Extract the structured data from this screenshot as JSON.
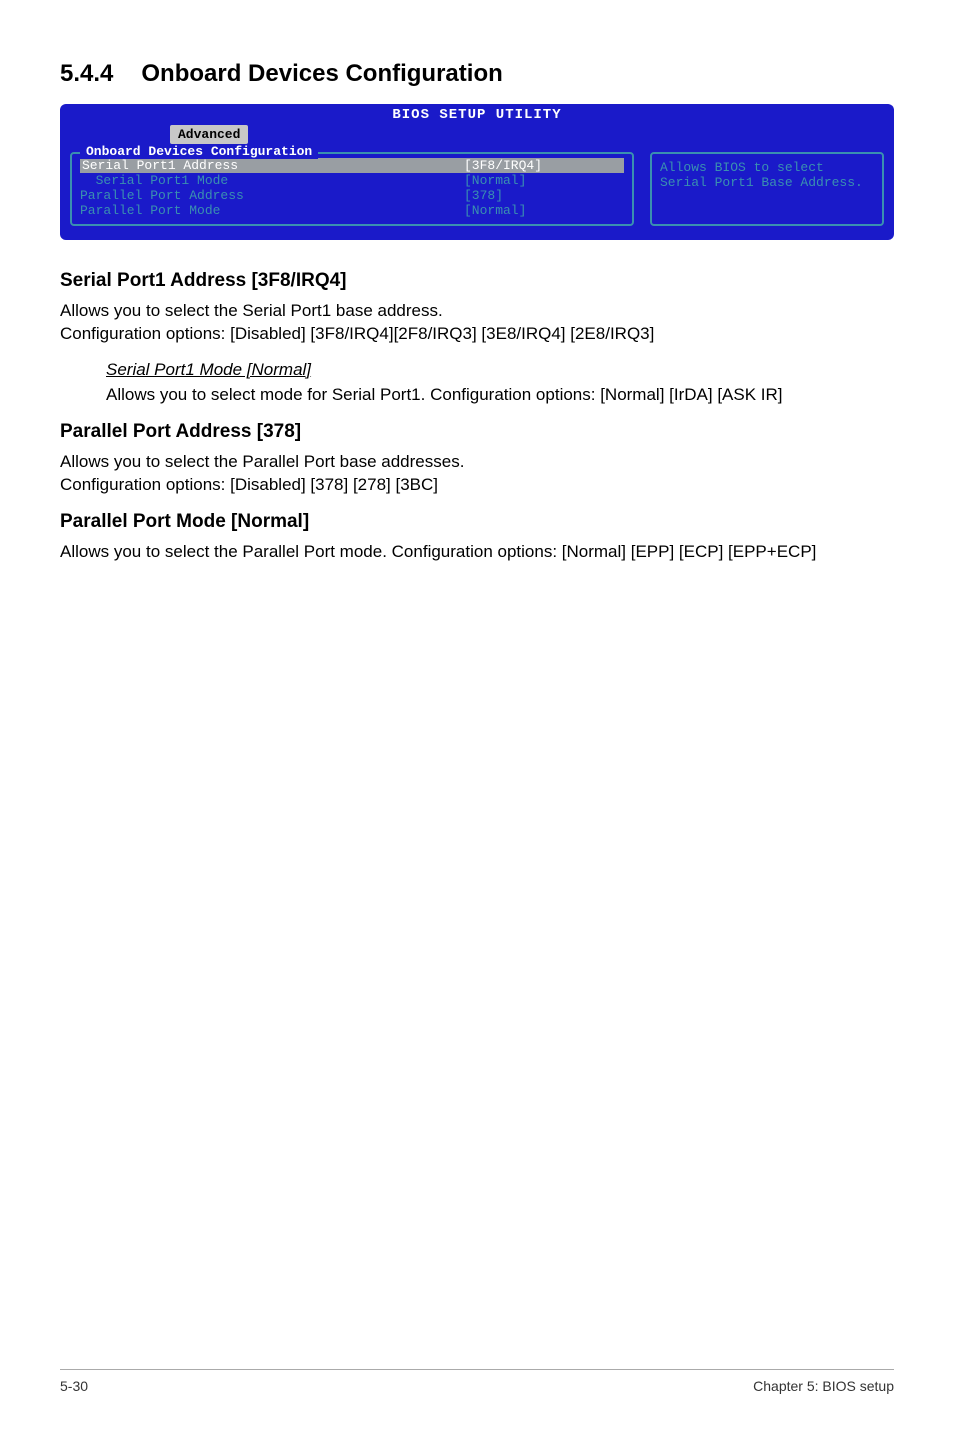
{
  "section": {
    "number": "5.4.4",
    "title": "Onboard Devices Configuration"
  },
  "bios": {
    "app_title": "BIOS SETUP UTILITY",
    "tab": "Advanced",
    "panel_title": "Onboard Devices Configuration",
    "rows": [
      {
        "label": "Serial Port1 Address",
        "value": "[3F8/IRQ4]",
        "style": "sel"
      },
      {
        "label": "  Serial Port1 Mode",
        "value": "[Normal]",
        "style": "dim"
      },
      {
        "label": "Parallel Port Address",
        "value": "[378]",
        "style": "dim"
      },
      {
        "label": "Parallel Port Mode",
        "value": "[Normal]",
        "style": "dim"
      }
    ],
    "help": "Allows BIOS to select Serial Port1 Base Address."
  },
  "subs": [
    {
      "heading": "Serial Port1 Address [3F8/IRQ4]",
      "body": "Allows you to select the Serial Port1 base address.\nConfiguration options: [Disabled] [3F8/IRQ4][2F8/IRQ3] [3E8/IRQ4] [2E8/IRQ3]",
      "opts": [
        {
          "title": "Serial Port1 Mode [Normal]",
          "body": "Allows you to select mode for Serial Port1. Configuration options: [Normal] [IrDA] [ASK IR]"
        }
      ]
    },
    {
      "heading": "Parallel Port Address [378]",
      "body": "Allows you to select the Parallel Port base addresses.\nConfiguration options: [Disabled] [378] [278] [3BC]",
      "opts": []
    },
    {
      "heading": "Parallel Port Mode [Normal]",
      "body": "Allows you to select the Parallel Port  mode. Configuration options: [Normal] [EPP] [ECP] [EPP+ECP]",
      "opts": []
    }
  ],
  "footer": {
    "left": "5-30",
    "right": "Chapter 5: BIOS setup"
  }
}
